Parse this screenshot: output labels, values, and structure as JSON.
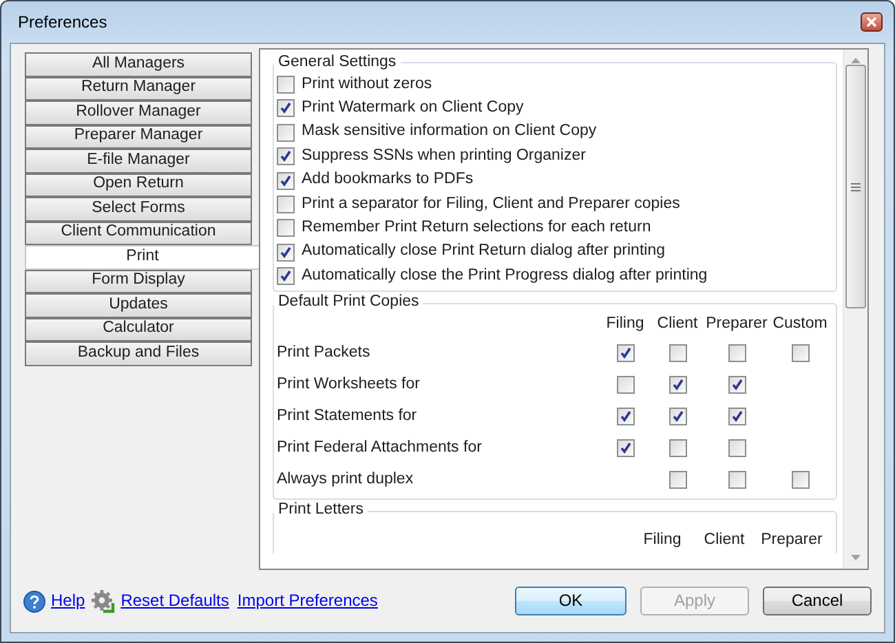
{
  "window": {
    "title": "Preferences"
  },
  "sidebar": {
    "items": [
      {
        "label": "All Managers",
        "selected": false
      },
      {
        "label": "Return Manager",
        "selected": false
      },
      {
        "label": "Rollover Manager",
        "selected": false
      },
      {
        "label": "Preparer Manager",
        "selected": false
      },
      {
        "label": "E-file Manager",
        "selected": false
      },
      {
        "label": "Open Return",
        "selected": false
      },
      {
        "label": "Select Forms",
        "selected": false
      },
      {
        "label": "Client Communication",
        "selected": false
      },
      {
        "label": "Print",
        "selected": true
      },
      {
        "label": "Form Display",
        "selected": false
      },
      {
        "label": "Updates",
        "selected": false
      },
      {
        "label": "Calculator",
        "selected": false
      },
      {
        "label": "Backup and Files",
        "selected": false
      }
    ]
  },
  "general_settings": {
    "title": "General Settings",
    "options": [
      {
        "label": "Print without zeros",
        "checked": false
      },
      {
        "label": "Print Watermark on Client Copy",
        "checked": true
      },
      {
        "label": "Mask sensitive information on Client Copy",
        "checked": false
      },
      {
        "label": "Suppress SSNs when printing Organizer",
        "checked": true
      },
      {
        "label": "Add bookmarks to PDFs",
        "checked": true
      },
      {
        "label": "Print a separator for Filing, Client and Preparer copies",
        "checked": false
      },
      {
        "label": "Remember Print Return selections for each return",
        "checked": false
      },
      {
        "label": "Automatically close Print Return dialog after printing",
        "checked": true
      },
      {
        "label": "Automatically close the Print Progress dialog after printing",
        "checked": true
      }
    ]
  },
  "default_print_copies": {
    "title": "Default Print Copies",
    "columns": [
      "Filing",
      "Client",
      "Preparer",
      "Custom"
    ],
    "rows": [
      {
        "label": "Print Packets",
        "filing": true,
        "client": false,
        "preparer": false,
        "custom": false
      },
      {
        "label": "Print Worksheets for",
        "filing": false,
        "client": true,
        "preparer": true
      },
      {
        "label": "Print Statements for",
        "filing": true,
        "client": true,
        "preparer": true
      },
      {
        "label": "Print Federal Attachments for",
        "filing": true,
        "client": false,
        "preparer": false
      },
      {
        "label": "Always print duplex",
        "client": false,
        "preparer": false,
        "custom": false
      }
    ]
  },
  "print_letters": {
    "title": "Print Letters",
    "columns": [
      "Filing",
      "Client",
      "Preparer"
    ]
  },
  "footer": {
    "links": [
      "Help",
      "Reset Defaults",
      "Import Preferences"
    ],
    "buttons": [
      {
        "label": "OK",
        "disabled": false,
        "focused": true
      },
      {
        "label": "Apply",
        "disabled": true,
        "focused": false
      },
      {
        "label": "Cancel",
        "disabled": false,
        "focused": false
      }
    ]
  }
}
